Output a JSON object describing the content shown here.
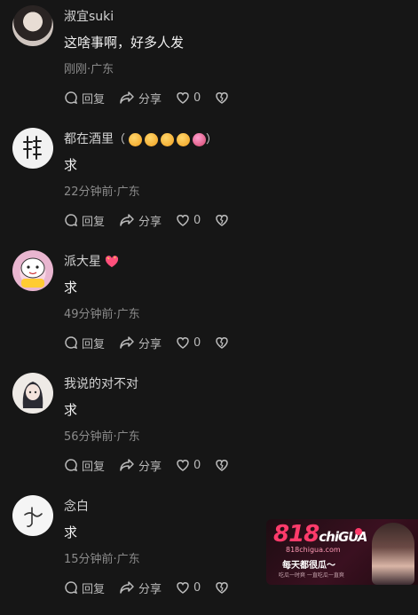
{
  "actions": {
    "reply_label": "回复",
    "share_label": "分享"
  },
  "comments": [
    {
      "name": "淑宜suki",
      "text": "这啥事啊，好多人发",
      "meta": "刚刚·广东",
      "likes": "0"
    },
    {
      "name": "都在酒里",
      "name_suffix": "（",
      "name_suffix_close": "）",
      "text": "求",
      "meta": "22分钟前·广东",
      "likes": "0",
      "avatar_text": "都在\n酒里"
    },
    {
      "name": "派大星",
      "text": "求",
      "meta": "49分钟前·广东",
      "likes": "0"
    },
    {
      "name": "我说的对不对",
      "text": "求",
      "meta": "56分钟前·广东",
      "likes": "0"
    },
    {
      "name": "念白",
      "text": "求",
      "meta": "15分钟前·广东",
      "likes": "0"
    }
  ],
  "ad": {
    "logo_main": "818",
    "logo_sub": "chiGUA",
    "url": "818chigua.com",
    "slogan": "每天都很瓜～",
    "small_text": "吃瓜一时爽 一直吃瓜一直爽",
    "colors": {
      "brand": "#ff3b6b"
    }
  },
  "colors": {
    "background": "#161616",
    "meta": "#8b8b8b",
    "text": "#f0f0f0"
  }
}
